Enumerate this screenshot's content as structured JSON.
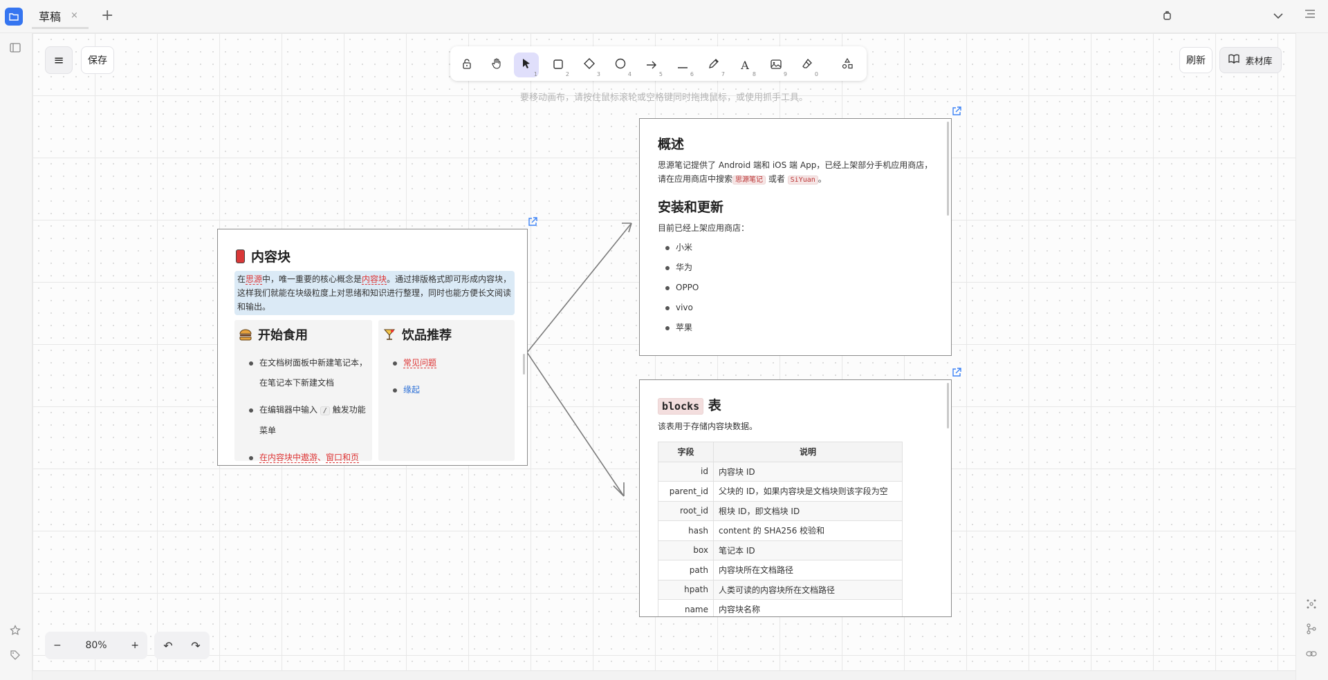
{
  "tabs": [
    {
      "label": "草稿",
      "close": "×"
    }
  ],
  "tab_add": "+",
  "actions": {
    "menu": "≡",
    "save": "保存",
    "refresh": "刷新",
    "library": "素材库"
  },
  "toolbar": {
    "tools": [
      {
        "name": "lock",
        "key": ""
      },
      {
        "name": "hand",
        "key": ""
      },
      {
        "name": "select",
        "key": "1"
      },
      {
        "name": "rectangle",
        "key": "2"
      },
      {
        "name": "diamond",
        "key": "3"
      },
      {
        "name": "ellipse",
        "key": "4"
      },
      {
        "name": "arrow",
        "key": "5"
      },
      {
        "name": "line",
        "key": "6"
      },
      {
        "name": "pencil",
        "key": "7"
      },
      {
        "name": "text",
        "key": "8"
      },
      {
        "name": "image",
        "key": "9"
      },
      {
        "name": "eraser",
        "key": "0"
      },
      {
        "name": "library",
        "key": ""
      }
    ]
  },
  "hint": "要移动画布，请按住鼠标滚轮或空格键同时拖拽鼠标，或使用抓手工具。",
  "card1": {
    "title": "内容块",
    "intro_parts": [
      "在",
      "思源",
      "中，唯一重要的核心概念是",
      "内容块",
      "。通过排版格式即可形成内容块，这样我们就能在块级粒度上对思绪和知识进行整理，同时也能方便长文阅读和输出。"
    ],
    "left_title": "开始食用",
    "left_items": [
      "在文档树面板中新建笔记本，在笔记本下新建文档",
      "在编辑器中输入",
      "触发功能菜单"
    ],
    "slash": "/",
    "left_link1": "在内容块中遨游",
    "left_sep": "、",
    "left_link2": "窗口和页签",
    "right_title": "饮品推荐",
    "right_items": [
      "常见问题",
      "缘起"
    ]
  },
  "card2": {
    "h_overview": "概述",
    "p_overview_a": "思源笔记提供了 Android 端和 iOS 端 App，已经上架部分手机应用商店，请在应用商店中搜索",
    "code1": "思源笔记",
    "p_or": " 或者 ",
    "code2": "SiYuan",
    "p_end": "。",
    "h_install": "安装和更新",
    "p_install": "目前已经上架应用商店：",
    "stores": [
      "小米",
      "华为",
      "OPPO",
      "vivo",
      "苹果"
    ]
  },
  "card3": {
    "title_code": "blocks",
    "title_suffix": " 表",
    "desc": "该表用于存储内容块数据。",
    "headers": [
      "字段",
      "说明"
    ],
    "rows": [
      [
        "id",
        "内容块 ID"
      ],
      [
        "parent_id",
        "父块的 ID，如果内容块是文档块则该字段为空"
      ],
      [
        "root_id",
        "根块 ID，即文档块 ID"
      ],
      [
        "hash",
        "content 的 SHA256 校验和"
      ],
      [
        "box",
        "笔记本 ID"
      ],
      [
        "path",
        "内容块所在文档路径"
      ],
      [
        "hpath",
        "人类可读的内容块所在文档路径"
      ],
      [
        "name",
        "内容块名称"
      ]
    ]
  },
  "zoom": {
    "minus": "−",
    "value": "80%",
    "plus": "+"
  },
  "history": {
    "undo": "↶",
    "redo": "↷"
  },
  "colors": {
    "accent": "#3575f0",
    "active_tool": "#e0dffb",
    "link_red": "#d33",
    "link_blue": "#2b6fd6"
  }
}
